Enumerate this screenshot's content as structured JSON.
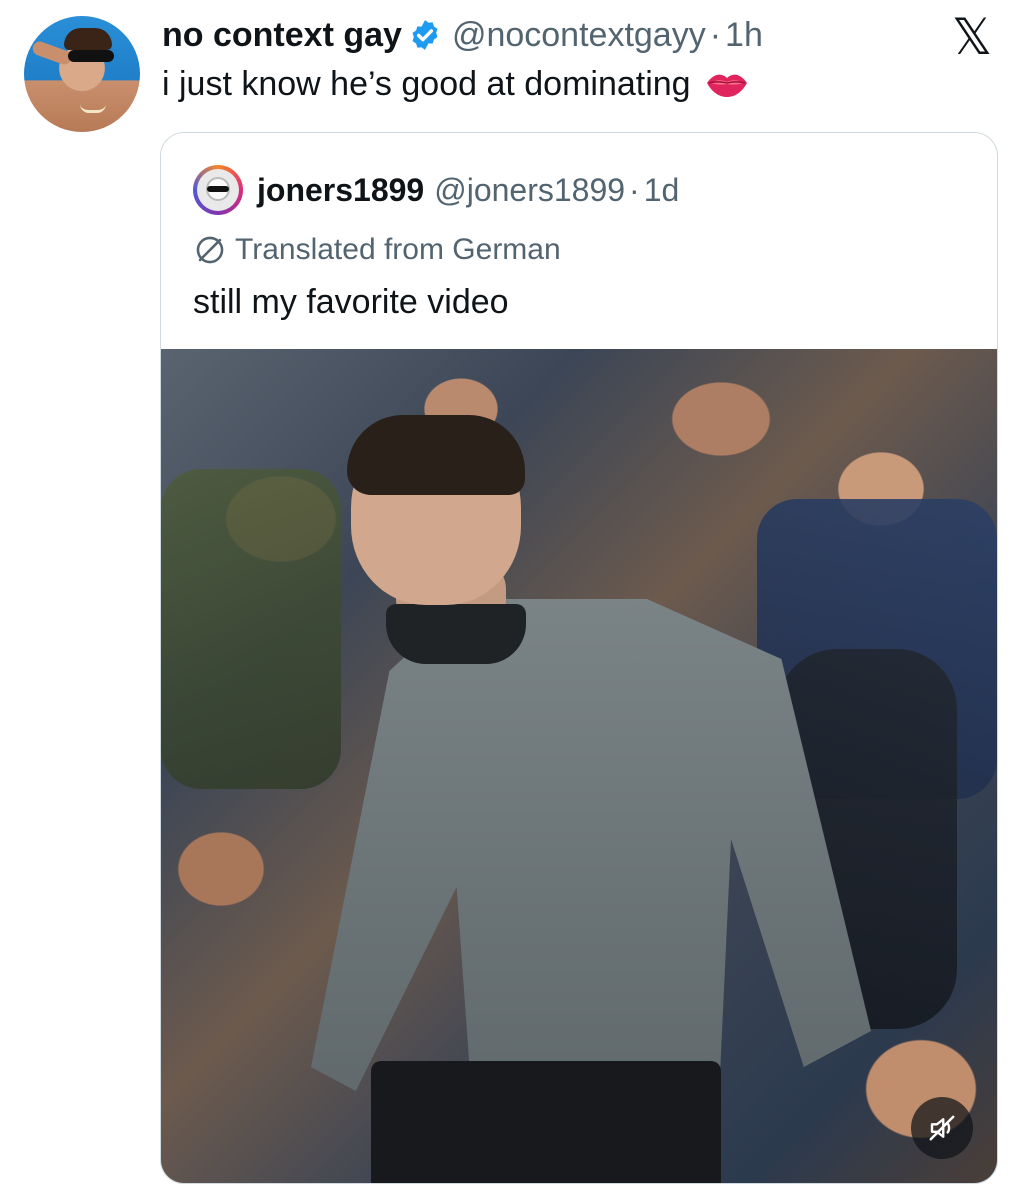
{
  "tweet": {
    "display_name": "no context gay",
    "handle": "@nocontextgayy",
    "separator": "·",
    "time": "1h",
    "text": "i just know he’s good at dominating",
    "emoji": "lips-icon",
    "verified_color": "#1d9bf0"
  },
  "brand": {
    "logo": "𝕏"
  },
  "quote": {
    "display_name": "joners1899",
    "handle": "@joners1899",
    "separator": "·",
    "time": "1d",
    "translated_label": "Translated from German",
    "text": "still my favorite video",
    "media": {
      "type": "video",
      "muted": true
    }
  },
  "colors": {
    "text_primary": "#0f1419",
    "text_secondary": "#536471",
    "border": "#cfd9de"
  }
}
